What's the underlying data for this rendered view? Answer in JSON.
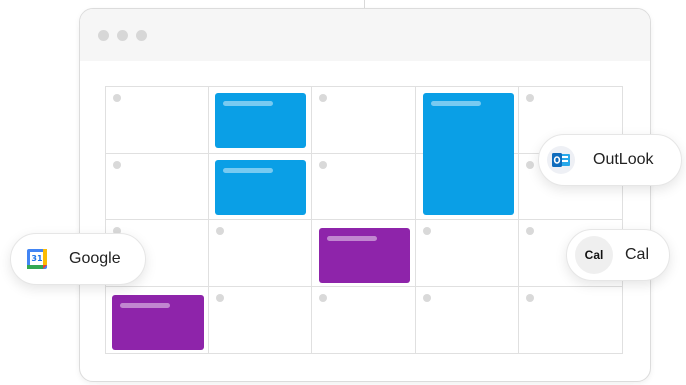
{
  "integrations": {
    "google": {
      "label": "Google",
      "icon": "google-calendar-icon",
      "icon_text": "31"
    },
    "outlook": {
      "label": "OutLook",
      "icon": "outlook-icon"
    },
    "cal": {
      "label": "Cal",
      "icon_text": "Cal"
    }
  },
  "colors": {
    "event_blue": "#0A9FE6",
    "event_purple": "#8E24AA",
    "titlebar": "#f6f6f6",
    "grid_line": "#e0e0e0"
  },
  "calendar": {
    "rows": 4,
    "columns": 5
  }
}
